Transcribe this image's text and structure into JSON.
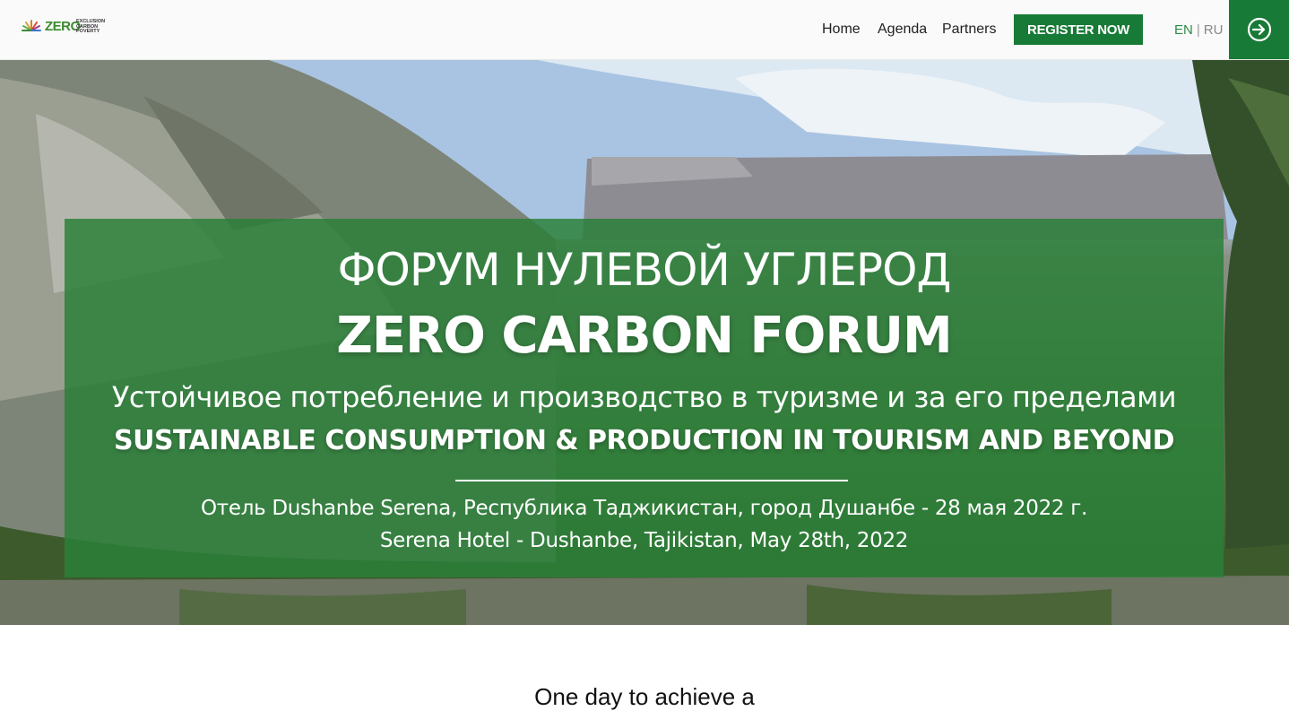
{
  "header": {
    "logo": {
      "wordmark": "ZERO",
      "lines": [
        "EXCLUSION",
        "CARBON",
        "POVERTY"
      ]
    },
    "nav": [
      {
        "label": "Home"
      },
      {
        "label": "Agenda"
      },
      {
        "label": "Partners"
      }
    ],
    "register_label": "REGISTER NOW",
    "lang": {
      "en": "EN",
      "separator": "|",
      "ru": "RU"
    },
    "login_icon": "sign-in-icon"
  },
  "hero": {
    "title_ru": "ФОРУМ НУЛЕВОЙ УГЛЕРОД",
    "title_en": "ZERO CARBON FORUM",
    "subtitle_ru": "Устойчивое потребление и производство в туризме и за его пределами",
    "subtitle_en": "SUSTAINABLE CONSUMPTION & PRODUCTION IN TOURISM AND BEYOND",
    "venue_ru": "Отель Dushanbe Serena, Республика Таджикистан, город Душанбе - 28 мая 2022 г.",
    "venue_en": "Serena Hotel - Dushanbe, Tajikistan, May 28th, 2022"
  },
  "section": {
    "heading": "One day to achieve a"
  },
  "colors": {
    "brand_green": "#177a36",
    "banner_green": "#2a8038",
    "lang_active": "#2b8c46"
  }
}
